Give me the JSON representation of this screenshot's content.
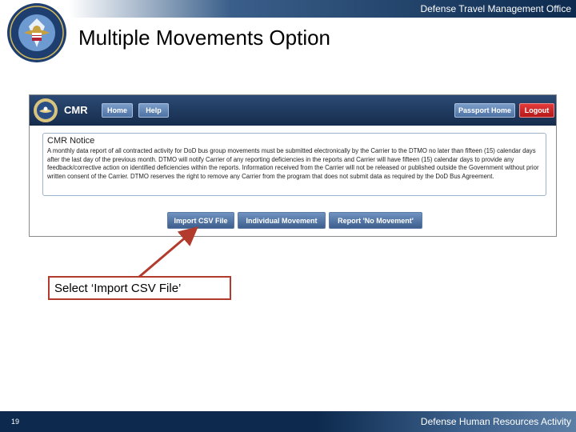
{
  "header": {
    "org": "Defense Travel Management Office",
    "title": "Multiple Movements Option"
  },
  "app": {
    "name": "CMR",
    "nav": [
      {
        "label": "Home"
      },
      {
        "label": "Help"
      }
    ],
    "passport_home": "Passport Home",
    "logout": "Logout",
    "notice": {
      "title": "CMR Notice",
      "body": "A monthly data report of all contracted activity for DoD bus group movements must be submitted electronically by the Carrier to the DTMO no later than fifteen (15) calendar days after the last day of the previous month. DTMO will notify Carrier of any reporting deficiencies in the reports and Carrier will have fifteen (15) calendar days to provide any feedback/corrective action on identified deficiencies within the reports. Information received from the Carrier will not be released or published outside the Government without prior written consent of the Carrier. DTMO reserves the right to remove any Carrier from the program that does not submit data as required by the DoD Bus Agreement."
    },
    "actions": {
      "import_csv": "Import CSV File",
      "individual": "Individual Movement",
      "no_movement": "Report 'No Movement'"
    }
  },
  "callout": {
    "text": "Select ‘Import CSV File’"
  },
  "footer": {
    "slide_number": "19",
    "org": "Defense Human Resources Activity"
  },
  "colors": {
    "navy": "#0d2a4e",
    "button_blue": "#4d73a5",
    "logout_red": "#c62020",
    "callout_red": "#b23b2d"
  }
}
